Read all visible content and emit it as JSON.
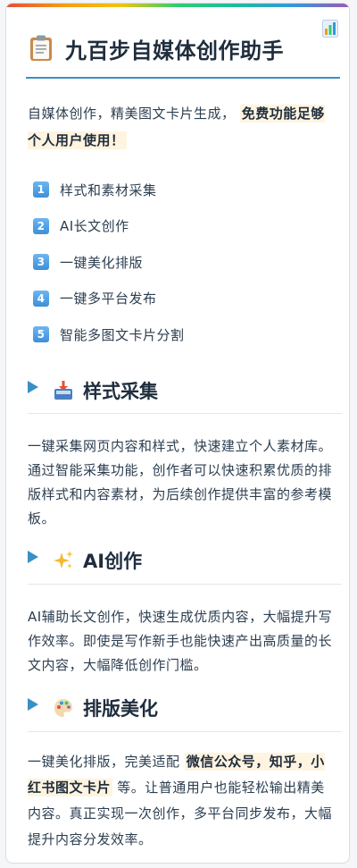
{
  "header": {
    "title": "九百步自媒体创作助手"
  },
  "intro": {
    "text": "自媒体创作，精美图文卡片生成，",
    "highlight": "免费功能足够个人用户使用！"
  },
  "features": [
    {
      "num": "1",
      "label": "样式和素材采集"
    },
    {
      "num": "2",
      "label": "AI长文创作"
    },
    {
      "num": "3",
      "label": "一键美化排版"
    },
    {
      "num": "4",
      "label": "一键多平台发布"
    },
    {
      "num": "5",
      "label": "智能多图文卡片分割"
    }
  ],
  "sections": {
    "collect": {
      "title": "样式采集",
      "icon": "inbox-tray-icon",
      "body": "一键采集网页内容和样式，快速建立个人素材库。通过智能采集功能，创作者可以快速积累优质的排版样式和内容素材，为后续创作提供丰富的参考模板。"
    },
    "ai": {
      "title": "AI创作",
      "icon": "sparkles-icon",
      "body": "AI辅助长文创作，快速生成优质内容，大幅提升写作效率。即使是写作新手也能快速产出高质量的长文内容，大幅降低创作门槛。"
    },
    "layout": {
      "title": "排版美化",
      "icon": "palette-icon",
      "body_before": "一键美化排版，完美适配 ",
      "highlight": "微信公众号，知乎，小红书图文卡片",
      "body_after": " 等。让普通用户也能轻松输出精美内容。真正实现一次创作，多平台同步发布，大幅提升内容分发效率。"
    }
  },
  "colors": {
    "accent": "#3a8fc4",
    "highlight_bg": "#fff4e0",
    "badge": "#3d8fd9"
  }
}
